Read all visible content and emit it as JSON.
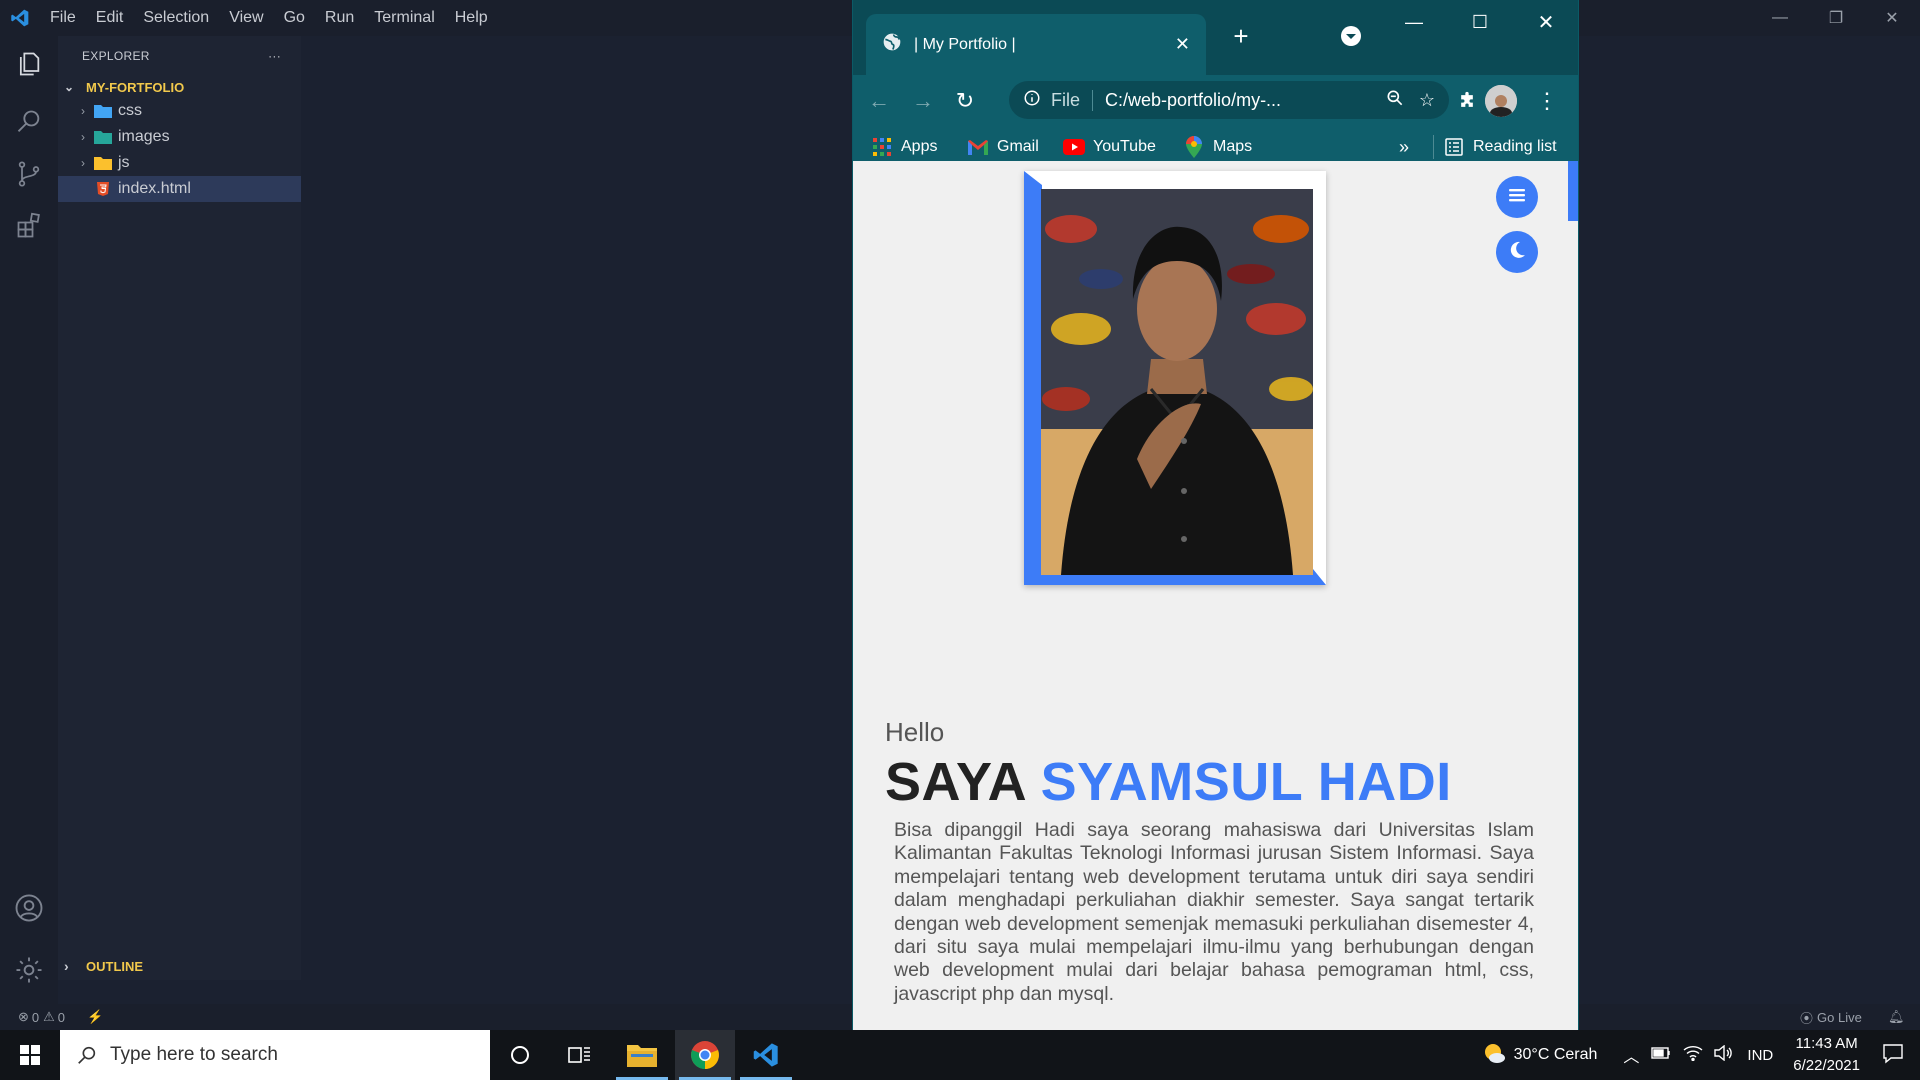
{
  "vscode": {
    "menu": [
      "File",
      "Edit",
      "Selection",
      "View",
      "Go",
      "Run",
      "Terminal",
      "Help"
    ],
    "explorer_title": "EXPLORER",
    "explorer_more": "···",
    "folder": "MY-FORTFOLIO",
    "tree": [
      {
        "label": "css",
        "type": "folder"
      },
      {
        "label": "images",
        "type": "folder"
      },
      {
        "label": "js",
        "type": "folder"
      },
      {
        "label": "index.html",
        "type": "file"
      }
    ],
    "outline": "OUTLINE",
    "status": {
      "errors": "0",
      "warnings": "0",
      "go_live": "Go Live"
    }
  },
  "chrome": {
    "tab_title": "| My Portfolio |",
    "url_scheme": "File",
    "url": "C:/web-portfolio/my-...",
    "bookmarks": [
      "Apps",
      "Gmail",
      "YouTube",
      "Maps"
    ],
    "bookmarks_overflow": "»",
    "reading_list": "Reading list"
  },
  "page": {
    "greeting": "Hello",
    "name_prefix": "SAYA",
    "name_highlight": "SYAMSUL HADI",
    "bio": "Bisa dipanggil Hadi saya seorang mahasiswa dari Universitas Islam Kalimantan Fakultas Teknologi Informasi jurusan Sistem Informasi. Saya mempelajari tentang web development terutama untuk diri saya sendiri dalam menghadapi perkuliahan diakhir semester. Saya sangat tertarik dengan web development semenjak memasuki perkuliahan disemester 4, dari situ saya mulai mempelajari ilmu-ilmu yang berhubungan dengan web development mulai dari belajar bahasa pemograman html, css, javascript php dan mysql."
  },
  "taskbar": {
    "search_placeholder": "Type here to search",
    "weather": "30°C  Cerah",
    "language": "IND",
    "time": "11:43 AM",
    "date": "6/22/2021"
  },
  "colors": {
    "accent": "#3d7cf7",
    "chrome_frame": "#0f5e6b",
    "vscode_bg": "#1b2130"
  }
}
